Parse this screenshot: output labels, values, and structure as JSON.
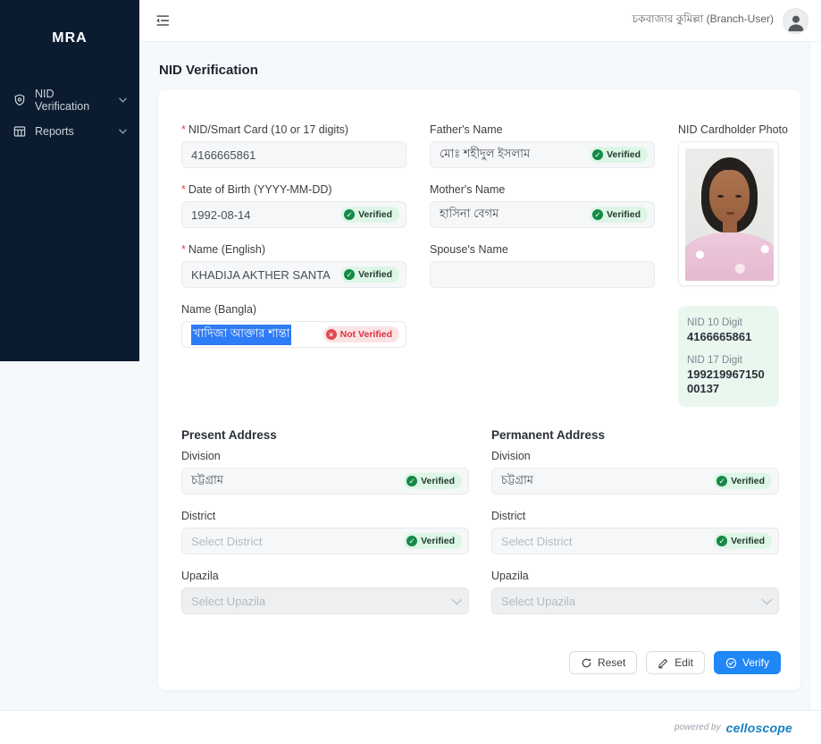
{
  "required_marker": "*",
  "sidebar": {
    "brand": "MRA",
    "items": [
      {
        "label": "NID Verification"
      },
      {
        "label": "Reports"
      }
    ]
  },
  "header": {
    "user_label": "চকবাজার কুমিল্লা (Branch-User)"
  },
  "page": {
    "title": "NID Verification"
  },
  "form": {
    "fields": {
      "nid": {
        "label": "NID/Smart Card (10 or 17 digits)",
        "value": "4166665861"
      },
      "dob": {
        "label": "Date of Birth (YYYY-MM-DD)",
        "value": "1992-08-14",
        "status": "Verified"
      },
      "name_en": {
        "label": "Name (English)",
        "value": "KHADIJA AKTHER SANTA",
        "status": "Verified"
      },
      "name_bn": {
        "label": "Name (Bangla)",
        "value": "খাদিজা আক্তার শান্তা",
        "status": "Not Verified"
      },
      "father": {
        "label": "Father's Name",
        "value": "মোঃ শহীদুল ইসলাম",
        "status": "Verified"
      },
      "mother": {
        "label": "Mother's Name",
        "value": "হাসিনা বেগম",
        "status": "Verified"
      },
      "spouse": {
        "label": "Spouse's Name",
        "value": ""
      }
    },
    "photo": {
      "label": "NID Cardholder Photo"
    },
    "nid_summary": {
      "nid10_label": "NID 10 Digit",
      "nid10_value": "4166665861",
      "nid17_label": "NID 17 Digit",
      "nid17_value": "19921996715000137"
    },
    "present_address": {
      "title": "Present Address",
      "division": {
        "label": "Division",
        "value": "চট্টগ্রাম",
        "status": "Verified"
      },
      "district": {
        "label": "District",
        "placeholder": "Select District",
        "status": "Verified"
      },
      "upazila": {
        "label": "Upazila",
        "placeholder": "Select Upazila"
      }
    },
    "permanent_address": {
      "title": "Permanent Address",
      "division": {
        "label": "Division",
        "value": "চট্টগ্রাম",
        "status": "Verified"
      },
      "district": {
        "label": "District",
        "placeholder": "Select District",
        "status": "Verified"
      },
      "upazila": {
        "label": "Upazila",
        "placeholder": "Select Upazila"
      }
    },
    "buttons": {
      "reset": "Reset",
      "edit": "Edit",
      "verify": "Verify"
    }
  },
  "footer": {
    "powered_by": "powered by",
    "brand": "celloscope"
  },
  "colors": {
    "sidebar_bg": "#0c1c30",
    "primary_blue": "#1f87f6",
    "verified_green": "#148a46",
    "not_verified_red": "#d8333f",
    "selection_blue": "#2e7cf6",
    "logo_blue": "#1781c2",
    "nid_box_bg": "#e9f7ef"
  }
}
